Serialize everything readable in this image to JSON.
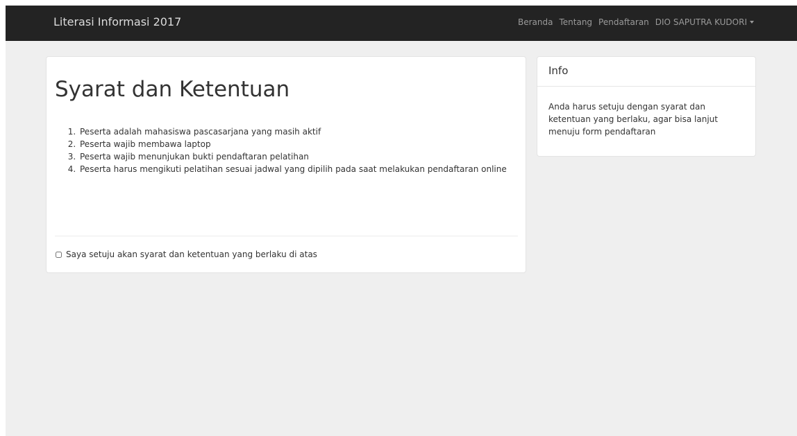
{
  "navbar": {
    "brand": "Literasi Informasi 2017",
    "links": [
      "Beranda",
      "Tentang",
      "Pendaftaran"
    ],
    "user": "DIO SAPUTRA KUDORI",
    "user_icon": "caret-down-icon"
  },
  "terms": {
    "title": "Syarat dan Ketentuan",
    "items": [
      "Peserta adalah mahasiswa pascasarjana yang masih aktif",
      "Peserta wajib membawa laptop",
      "Peserta wajib menunjukan bukti pendaftaran pelatihan",
      "Peserta harus mengikuti pelatihan sesuai jadwal yang dipilih pada saat melakukan pendaftaran online"
    ],
    "agree_label": "Saya setuju akan syarat dan ketentuan yang berlaku di atas",
    "agree_checked": false
  },
  "info": {
    "title": "Info",
    "body": "Anda harus setuju dengan syarat dan ketentuan yang berlaku, agar bisa lanjut menuju form pendaftaran"
  }
}
